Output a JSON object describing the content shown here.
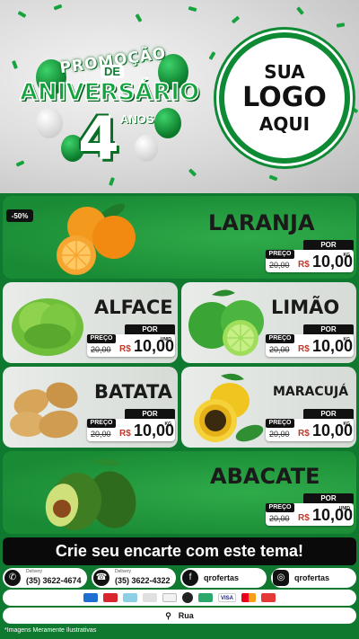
{
  "promo": {
    "line1": "PROMOÇÃO",
    "line2": "DE",
    "line3": "ANIVERSÁRIO",
    "number": "4",
    "years": "ANOS"
  },
  "logo": {
    "line1": "SUA",
    "line2": "LOGO",
    "line3": "AQUI"
  },
  "products": [
    {
      "name": "LARANJA",
      "discount": "-50%",
      "per": "POR",
      "price_label": "PREÇO",
      "old_price": "20,00",
      "currency": "R$",
      "price": "10,00",
      "unit": "KG"
    },
    {
      "name": "ALFACE",
      "per": "POR",
      "price_label": "PREÇO",
      "old_price": "20,00",
      "currency": "R$",
      "price": "10,00",
      "unit": "UNID"
    },
    {
      "name": "LIMÃO",
      "per": "POR",
      "price_label": "PREÇO",
      "old_price": "20,00",
      "currency": "R$",
      "price": "10,00",
      "unit": "KG"
    },
    {
      "name": "BATATA",
      "per": "POR",
      "price_label": "PREÇO",
      "old_price": "20,00",
      "currency": "R$",
      "price": "10,00",
      "unit": "KG"
    },
    {
      "name": "MARACUJÁ",
      "per": "POR",
      "price_label": "PREÇO",
      "old_price": "20,00",
      "currency": "R$",
      "price": "10,00",
      "unit": "KG"
    },
    {
      "name": "ABACATE",
      "per": "POR",
      "price_label": "PREÇO",
      "old_price": "20,00",
      "currency": "R$",
      "price": "10,00",
      "unit": "UNID"
    }
  ],
  "banner": "Crie seu encarte com este tema!",
  "contacts": {
    "whatsapp_label": "Delivery",
    "whatsapp_number": "(35) 3622-4674",
    "phone_label": "Delivery",
    "phone_number": "(35) 3622-4322",
    "facebook": "qrofertas",
    "instagram": "qrofertas"
  },
  "address": "Rua",
  "disclaimer": "*Imagens Meramente Ilustrativas",
  "colors": {
    "brand_green": "#0f7a2f",
    "panel_light": "#e9ece9",
    "accent_red": "#c0392b"
  }
}
